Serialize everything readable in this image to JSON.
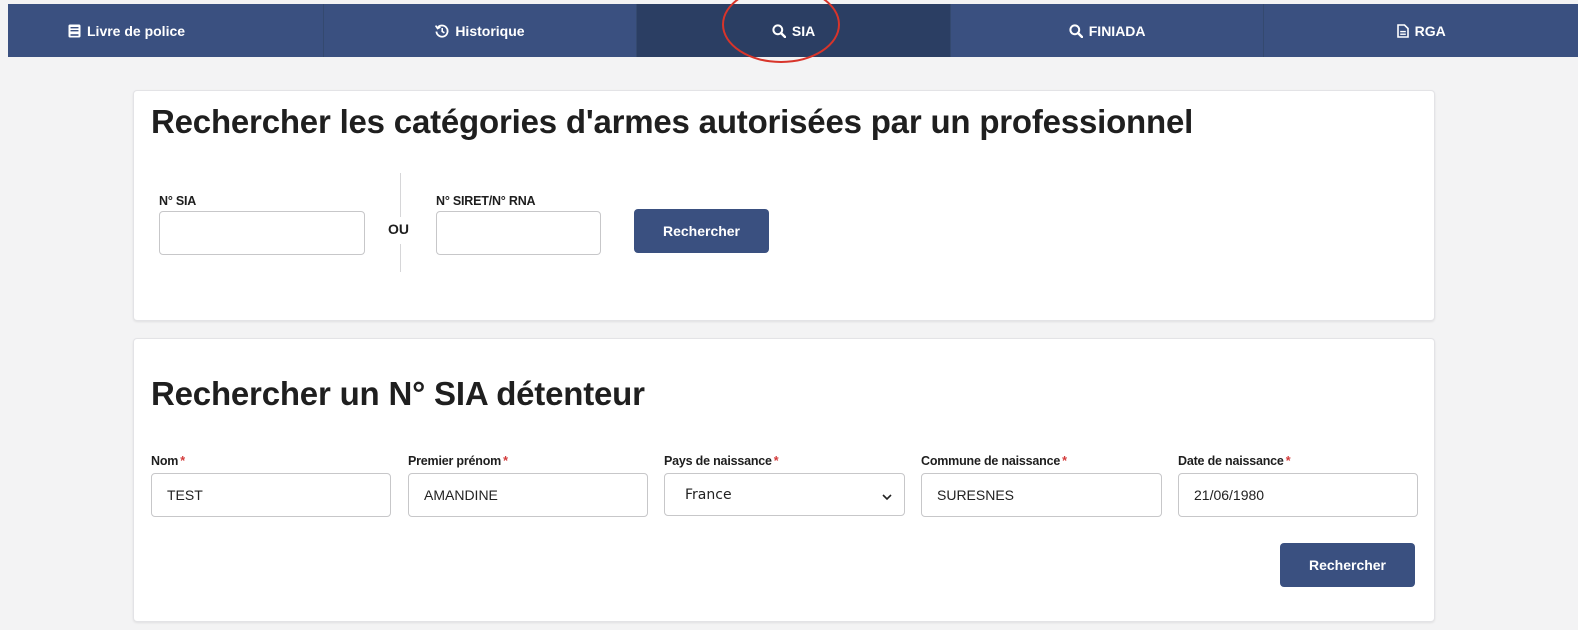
{
  "nav": {
    "tabs": [
      {
        "label": "Livre de police",
        "icon": "book-icon",
        "active": false
      },
      {
        "label": "Historique",
        "icon": "history-icon",
        "active": false
      },
      {
        "label": "SIA",
        "icon": "search-icon",
        "active": true
      },
      {
        "label": "FINIADA",
        "icon": "search-icon",
        "active": false
      },
      {
        "label": "RGA",
        "icon": "document-icon",
        "active": false
      }
    ]
  },
  "pro_search": {
    "title": "Rechercher les catégories d'armes autorisées par un professionnel",
    "sia_label": "N° SIA",
    "sia_value": "",
    "or_label": "OU",
    "siret_label": "N° SIRET/N° RNA",
    "siret_value": "",
    "button_label": "Rechercher"
  },
  "holder_search": {
    "title": "Rechercher un N° SIA détenteur",
    "required_mark": "*",
    "fields": {
      "nom": {
        "label": "Nom",
        "value": "TEST"
      },
      "prenom": {
        "label": "Premier prénom",
        "value": "AMANDINE"
      },
      "pays": {
        "label": "Pays de naissance",
        "value": "France"
      },
      "commune": {
        "label": "Commune de naissance",
        "value": "SURESNES"
      },
      "date": {
        "label": "Date de naissance",
        "value": "21/06/1980"
      }
    },
    "button_label": "Rechercher"
  },
  "colors": {
    "nav_bg": "#3a5080",
    "nav_active": "#2b3e63",
    "button_bg": "#3a5080",
    "required": "#d33a3a",
    "annotation": "#d8342a"
  }
}
